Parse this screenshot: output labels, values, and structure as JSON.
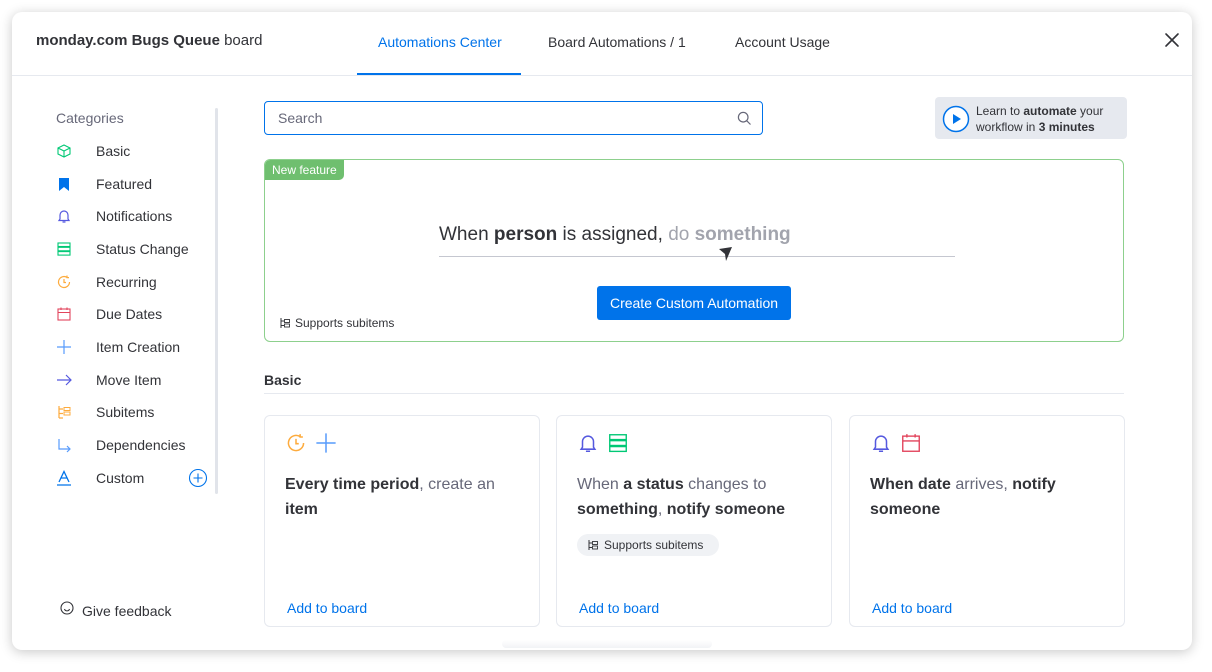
{
  "header": {
    "board_prefix": "monday.com Bugs Queue",
    "board_suffix": "board",
    "tabs": [
      {
        "label": "Automations Center",
        "active": true
      },
      {
        "label": "Board Automations / 1",
        "active": false
      },
      {
        "label": "Account Usage",
        "active": false
      }
    ],
    "close_icon": "close-icon"
  },
  "sidebar": {
    "title": "Categories",
    "items": [
      {
        "label": "Basic",
        "icon": "cube-icon",
        "color": "#00c875"
      },
      {
        "label": "Featured",
        "icon": "bookmark-icon",
        "color": "#0073ea"
      },
      {
        "label": "Notifications",
        "icon": "bell-icon",
        "color": "#5559df"
      },
      {
        "label": "Status Change",
        "icon": "status-icon",
        "color": "#00c875"
      },
      {
        "label": "Recurring",
        "icon": "recurring-icon",
        "color": "#fdab3d"
      },
      {
        "label": "Due Dates",
        "icon": "calendar-icon",
        "color": "#e2445c"
      },
      {
        "label": "Item Creation",
        "icon": "plus-icon",
        "color": "#579bfc"
      },
      {
        "label": "Move Item",
        "icon": "arrow-right-icon",
        "color": "#5559df"
      },
      {
        "label": "Subitems",
        "icon": "subitems-icon",
        "color": "#fdab3d"
      },
      {
        "label": "Dependencies",
        "icon": "dependency-icon",
        "color": "#579bfc"
      },
      {
        "label": "Custom",
        "icon": "custom-text-icon",
        "color": "#0073ea"
      }
    ],
    "feedback_label": "Give feedback"
  },
  "search": {
    "placeholder": "Search",
    "value": ""
  },
  "learn": {
    "pre": "Learn to ",
    "bold1": "automate",
    "mid": " your",
    "line2_pre": "workflow in ",
    "bold2": "3 minutes"
  },
  "feature": {
    "badge": "New feature",
    "sentence": {
      "w1": "When ",
      "b1": "person",
      "w2": " is assigned, ",
      "g1": "do ",
      "g2": "something"
    },
    "create_label": "Create Custom Automation",
    "supports_label": "Supports subitems"
  },
  "section": {
    "title": "Basic"
  },
  "cards": [
    {
      "icons": [
        "recurring-icon",
        "plus-icon"
      ],
      "b1": "Every time period",
      "t1": ", create an ",
      "b2": "item",
      "t2": "",
      "b3": "",
      "t3": "",
      "pill": "",
      "add_label": "Add to board"
    },
    {
      "icons": [
        "bell-icon",
        "status-icon"
      ],
      "b1": "",
      "t1": "When ",
      "b2": "a status",
      "t2": " changes to ",
      "b3": "something",
      "t3": ", ",
      "b4": "notify someone",
      "pill": "Supports subitems",
      "add_label": "Add to board"
    },
    {
      "icons": [
        "bell-icon",
        "calendar-icon"
      ],
      "b1": "When date",
      "t1": " arrives, ",
      "b2": "notify someone",
      "t2": "",
      "b3": "",
      "t3": "",
      "pill": "",
      "add_label": "Add to board"
    }
  ],
  "colors": {
    "accent": "#0073ea",
    "feature_border": "#8dd08d",
    "badge": "#6fbf6f"
  }
}
